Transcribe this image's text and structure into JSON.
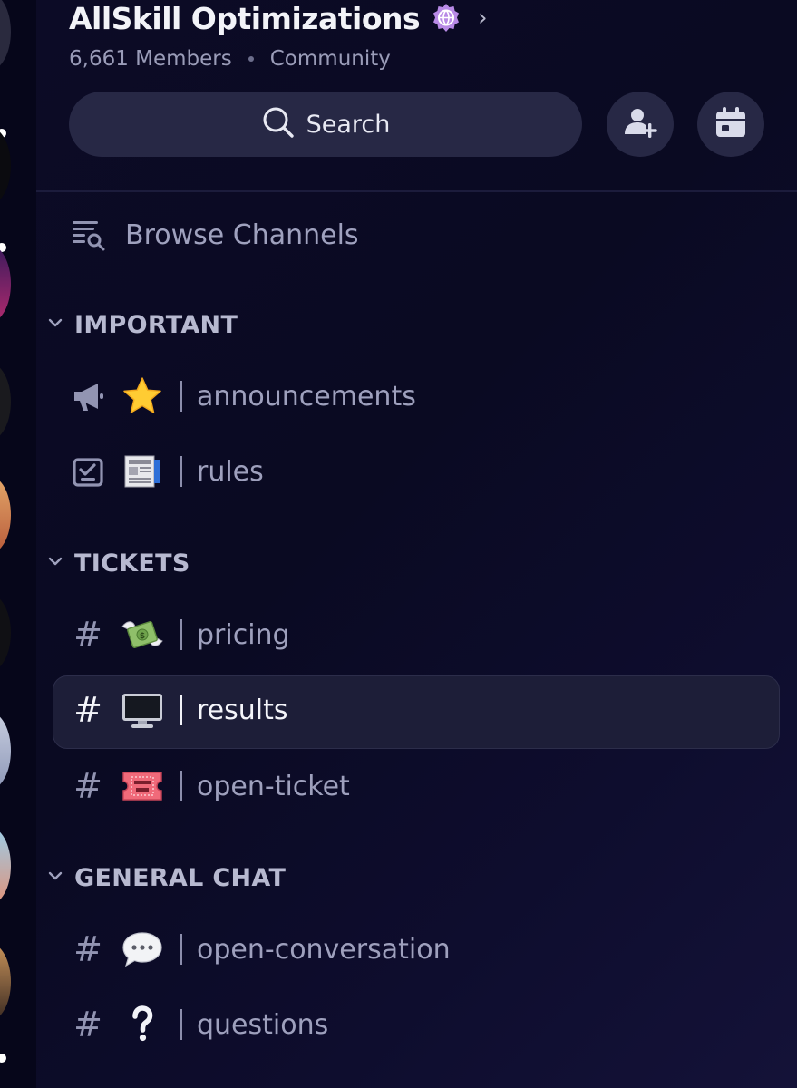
{
  "server": {
    "name": "AllSkill Optimizations",
    "members": "6,661 Members",
    "type": "Community"
  },
  "search": {
    "label": "Search"
  },
  "browse": {
    "label": "Browse Channels"
  },
  "categories": [
    {
      "name": "IMPORTANT",
      "channels": [
        {
          "icon": "megaphone-icon",
          "emoji": "star-emoji",
          "name": "announcements"
        },
        {
          "icon": "checklist-icon",
          "emoji": "newspaper-emoji",
          "name": "rules"
        }
      ]
    },
    {
      "name": "TICKETS",
      "channels": [
        {
          "icon": "hash-icon",
          "emoji": "money-wings-emoji",
          "name": "pricing"
        },
        {
          "icon": "hash-icon",
          "emoji": "desktop-computer-emoji",
          "name": "results",
          "selected": true
        },
        {
          "icon": "hash-icon",
          "emoji": "ticket-emoji",
          "name": "open-ticket"
        }
      ]
    },
    {
      "name": "GENERAL CHAT",
      "channels": [
        {
          "icon": "hash-icon",
          "emoji": "speech-bubble-emoji",
          "name": "open-conversation"
        },
        {
          "icon": "hash-icon",
          "emoji": "question-mark-emoji",
          "name": "questions"
        }
      ]
    }
  ],
  "glyphs": {
    "hash": "#",
    "chevron_right": "›"
  },
  "colors": {
    "accent": "#b88ae6",
    "selected_bg": "#1d1e38",
    "background": "#0c0b26"
  }
}
